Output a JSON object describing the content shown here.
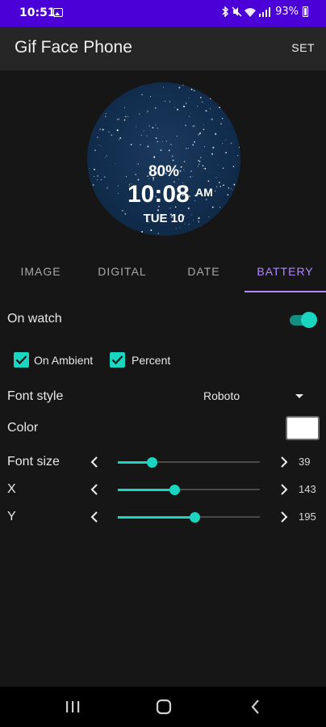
{
  "status_bar": {
    "time": "10:51",
    "battery_text": "93%",
    "icons": [
      "image-icon",
      "bluetooth-icon",
      "mute-icon",
      "wifi-icon",
      "cell-signal-icon",
      "battery-icon"
    ]
  },
  "app_bar": {
    "title": "Gif Face Phone",
    "action_label": "SET"
  },
  "preview": {
    "battery_percent": "80%",
    "time": "10:08",
    "ampm": "AM",
    "date": "TUE 10",
    "background_color": "#112c4c"
  },
  "tabs": [
    {
      "label": "IMAGE",
      "active": false
    },
    {
      "label": "DIGITAL",
      "active": false
    },
    {
      "label": "DATE",
      "active": false
    },
    {
      "label": "BATTERY",
      "active": true
    }
  ],
  "settings": {
    "on_watch": {
      "label": "On watch",
      "enabled": true
    },
    "on_ambient": {
      "label": "On Ambient",
      "checked": true
    },
    "percent": {
      "label": "Percent",
      "checked": true
    },
    "font_style": {
      "label": "Font style",
      "value": "Roboto"
    },
    "color": {
      "label": "Color",
      "value": "#ffffff"
    },
    "font_size": {
      "label": "Font size",
      "value": "39",
      "fraction": 0.24
    },
    "x": {
      "label": "X",
      "value": "143",
      "fraction": 0.4
    },
    "y": {
      "label": "Y",
      "value": "195",
      "fraction": 0.54
    }
  },
  "colors": {
    "accent": "#1ad6c0",
    "tab_active": "#b388ff",
    "status_bar": "#4a00d6"
  },
  "nav_bar": {
    "buttons": [
      "recents-icon",
      "home-icon",
      "back-icon"
    ]
  }
}
